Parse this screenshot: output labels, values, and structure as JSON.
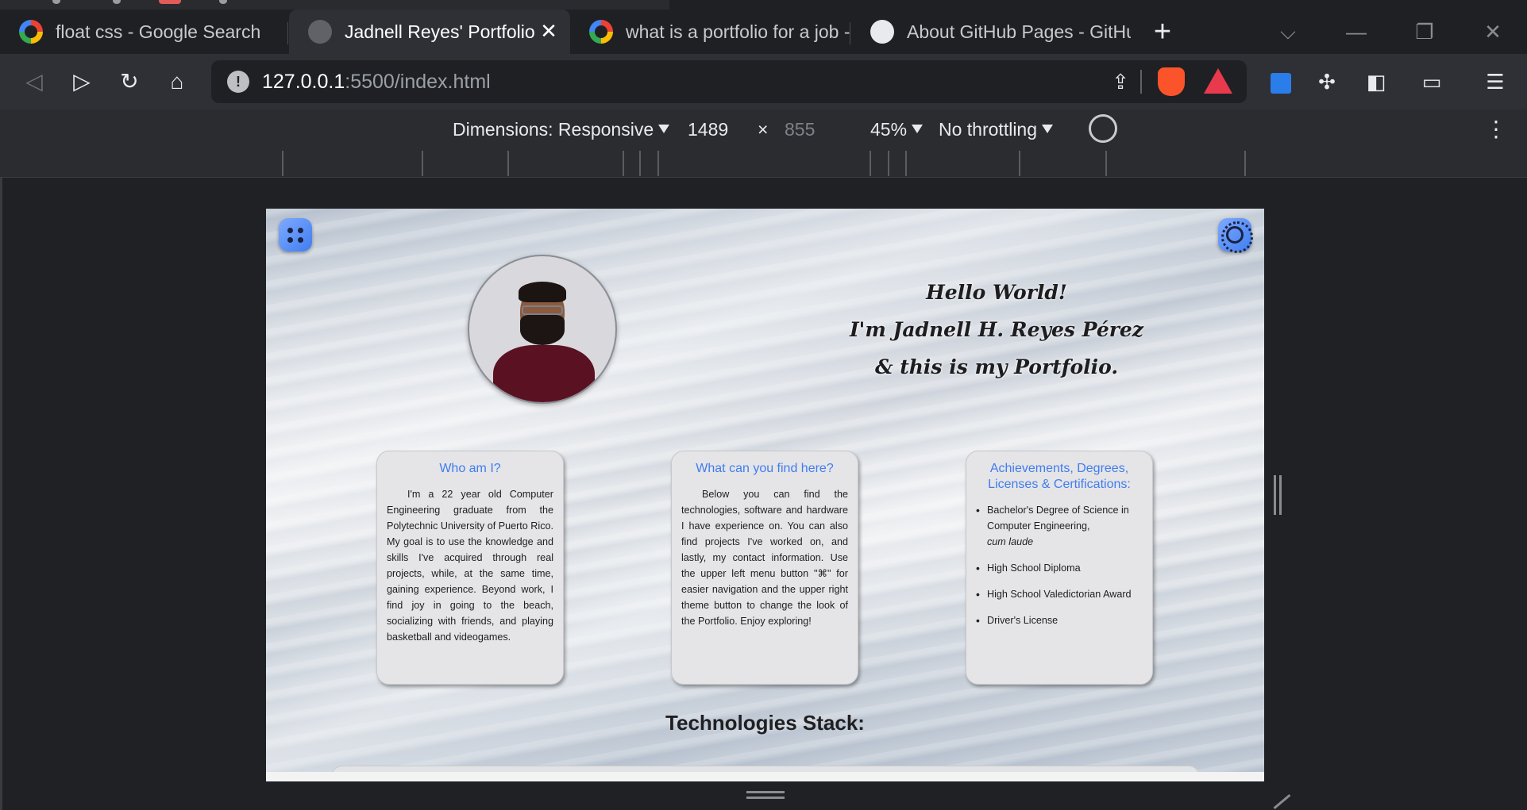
{
  "browser": {
    "tabs": [
      {
        "title": "float css - Google Search",
        "icon": "google-icon",
        "active": false
      },
      {
        "title": "Jadnell Reyes' Portfolio",
        "icon": "globe-icon",
        "active": true
      },
      {
        "title": "what is a portfolio for a job -",
        "icon": "google-icon",
        "active": false
      },
      {
        "title": "About GitHub Pages - GitHul",
        "icon": "github-icon",
        "active": false
      }
    ],
    "new_tab": "+",
    "close_tab": "✕",
    "url": {
      "host": "127.0.0.1",
      "rest": ":5500/index.html"
    }
  },
  "devtools": {
    "dimensions_label": "Dimensions: Responsive",
    "width": "1489",
    "times": "×",
    "height": "855",
    "zoom": "45%",
    "throttling": "No throttling"
  },
  "page": {
    "greeting": [
      "Hello World!",
      "I'm Jadnell H. Reyes Pérez",
      "& this is my Portfolio."
    ],
    "cards": {
      "who": {
        "title": "Who am I?",
        "body": "I'm a 22 year old Computer Engineering graduate from the Polytechnic University of Puerto Rico. My goal is to use the knowledge and skills I've acquired through real projects, while, at the same time, gaining experience. Beyond work, I find joy in going to the beach, socializing with friends, and playing basketball and videogames."
      },
      "find": {
        "title": "What can you find here?",
        "body": "Below you can find the technologies, software and hardware I have experience on. You can also find projects I've worked on, and lastly, my contact information. Use the upper left menu button \"⌘\" for easier navigation and the upper right theme button to change the look of the Portfolio. Enjoy exploring!"
      },
      "achievements": {
        "title": "Achievements, Degrees, Licenses & Certifications:",
        "items": [
          {
            "text": "Bachelor's Degree of Science in Computer Engineering,",
            "note": "cum laude"
          },
          {
            "text": "High School Diploma"
          },
          {
            "text": "High School Valedictorian Award"
          },
          {
            "text": "Driver's License"
          }
        ]
      }
    },
    "tech_title": "Technologies Stack:"
  },
  "colors": {
    "accent": "#3f7df0",
    "card_bg": "#e5e4e6",
    "browser_bg": "#1f2023"
  }
}
